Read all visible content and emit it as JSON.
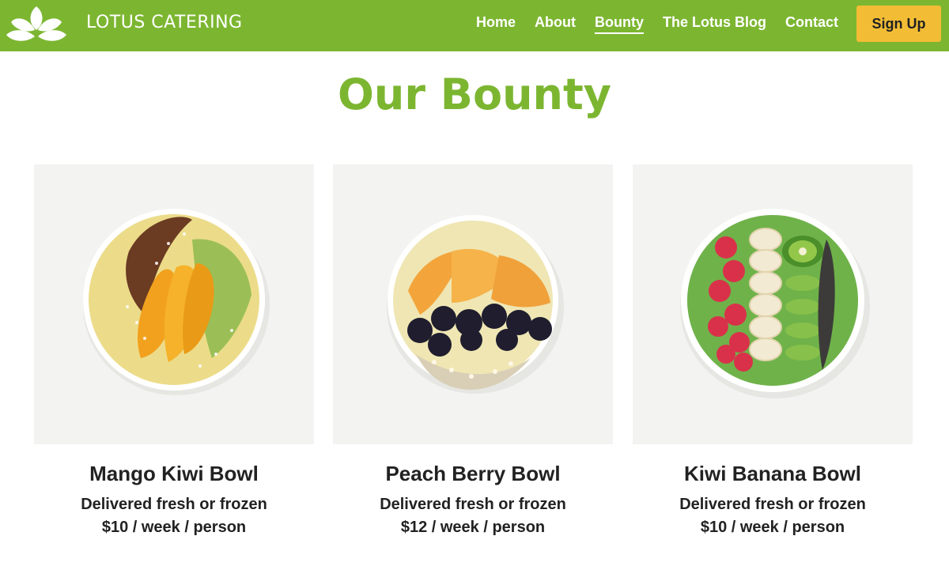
{
  "brand": {
    "name": "LOTUS CATERING"
  },
  "nav": {
    "items": [
      {
        "label": "Home"
      },
      {
        "label": "About"
      },
      {
        "label": "Bounty"
      },
      {
        "label": "The Lotus Blog"
      },
      {
        "label": "Contact"
      }
    ],
    "active": "Bounty",
    "signup_label": "Sign Up"
  },
  "page": {
    "title": "Our Bounty"
  },
  "products": [
    {
      "name": "Mango Kiwi Bowl",
      "subtitle": "Delivered fresh or frozen",
      "price": "$10 / week / person"
    },
    {
      "name": "Peach Berry Bowl",
      "subtitle": "Delivered fresh or frozen",
      "price": "$12 / week / person"
    },
    {
      "name": "Kiwi Banana Bowl",
      "subtitle": "Delivered fresh or frozen",
      "price": "$10 / week / person"
    }
  ],
  "colors": {
    "brand_green": "#7cb631",
    "signup_yellow": "#f2bd35",
    "card_bg": "#f3f3f2"
  },
  "icons": {
    "logo": "lotus-icon"
  }
}
